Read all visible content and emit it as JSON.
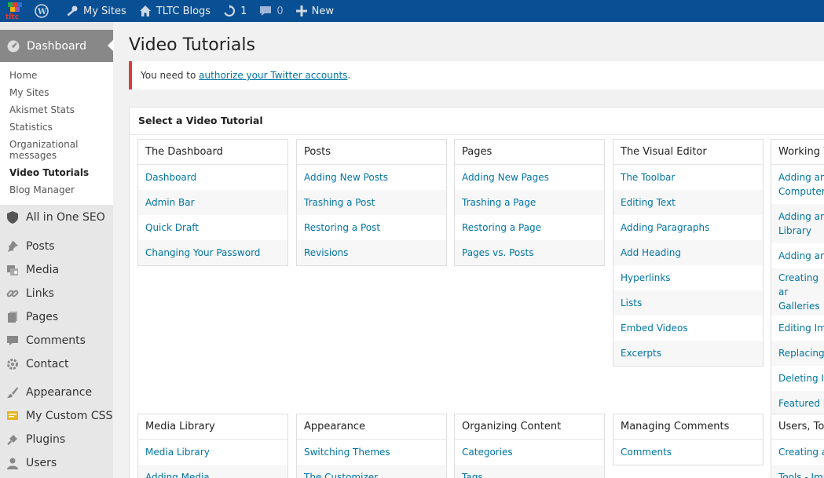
{
  "adminbar": {
    "logo_text": "tltc",
    "my_sites": "My Sites",
    "site_name": "TLTC Blogs",
    "updates_count": "1",
    "comments_count": "0",
    "new_label": "New"
  },
  "sidebar": {
    "dashboard_label": "Dashboard",
    "submenu": [
      "Home",
      "My Sites",
      "Akismet Stats",
      "Statistics",
      "Organizational messages",
      "Video Tutorials",
      "Blog Manager"
    ],
    "seo_label": "All in One SEO",
    "items": [
      "Posts",
      "Media",
      "Links",
      "Pages",
      "Comments",
      "Contact",
      "Appearance",
      "My Custom CSS",
      "Plugins",
      "Users"
    ]
  },
  "main": {
    "title": "Video Tutorials",
    "notice_prefix": "You need to ",
    "notice_link": "authorize your Twitter accounts",
    "notice_suffix": ".",
    "panel_title": "Select a Video Tutorial",
    "sections": [
      {
        "title": "The Dashboard",
        "links": [
          "Dashboard",
          "Admin Bar",
          "Quick Draft",
          "Changing Your Password"
        ]
      },
      {
        "title": "Posts",
        "links": [
          "Adding New Posts",
          "Trashing a Post",
          "Restoring a Post",
          "Revisions"
        ]
      },
      {
        "title": "Pages",
        "links": [
          "Adding New Pages",
          "Trashing a Page",
          "Restoring a Page",
          "Pages vs. Posts"
        ]
      },
      {
        "title": "The Visual Editor",
        "links": [
          "The Toolbar",
          "Editing Text",
          "Adding Paragraphs",
          "Add Heading",
          "Hyperlinks",
          "Lists",
          "Embed Videos",
          "Excerpts"
        ]
      },
      {
        "title": "Working W",
        "links": [
          "Adding an Computer",
          "Adding an Library",
          "Adding an",
          "Creating ar Galleries",
          "Editing Ima",
          "Replacing a",
          "Deleting In",
          "Featured In"
        ]
      },
      {
        "title": "Media Library",
        "links": [
          "Media Library",
          "Adding Media"
        ]
      },
      {
        "title": "Appearance",
        "links": [
          "Switching Themes",
          "The Customizer"
        ]
      },
      {
        "title": "Organizing Content",
        "links": [
          "Categories",
          "Tags"
        ]
      },
      {
        "title": "Managing Comments",
        "links": [
          "Comments"
        ]
      },
      {
        "title": "Users, Too",
        "links": [
          "Creating an",
          "Tools - Imp"
        ]
      }
    ]
  },
  "colors": {
    "adminbar": "#084f94",
    "sidebar_bg": "#e7e7e7",
    "current_menu": "#888888",
    "link": "#0074a2",
    "notice_border": "#dd3d36"
  }
}
